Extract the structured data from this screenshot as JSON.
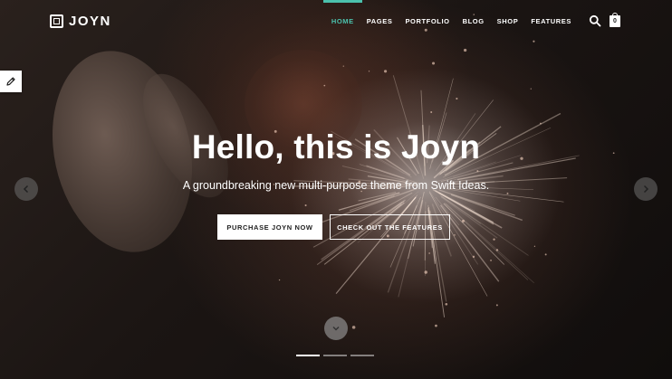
{
  "brand": {
    "name": "JOYN"
  },
  "nav": {
    "items": [
      {
        "label": "HOME",
        "active": true
      },
      {
        "label": "PAGES",
        "active": false
      },
      {
        "label": "PORTFOLIO",
        "active": false
      },
      {
        "label": "BLOG",
        "active": false
      },
      {
        "label": "SHOP",
        "active": false
      },
      {
        "label": "FEATURES",
        "active": false
      }
    ],
    "search_icon": "search-icon",
    "cart": {
      "icon": "shopping-bag-icon",
      "count": "0"
    }
  },
  "side_tab": {
    "icon": "pencil-icon"
  },
  "hero": {
    "headline": "Hello, this is Joyn",
    "subheadline": "A groundbreaking new multi-purpose theme from Swift Ideas.",
    "primary_button": "PURCHASE JOYN NOW",
    "secondary_button": "CHECK OUT THE FEATURES",
    "prev_icon": "chevron-left-icon",
    "next_icon": "chevron-right-icon",
    "scroll_icon": "chevron-down-icon",
    "slides": {
      "count": 3,
      "active_index": 0
    }
  },
  "colors": {
    "accent": "#4bc1ad",
    "text": "#ffffff",
    "button_text": "#222222"
  }
}
